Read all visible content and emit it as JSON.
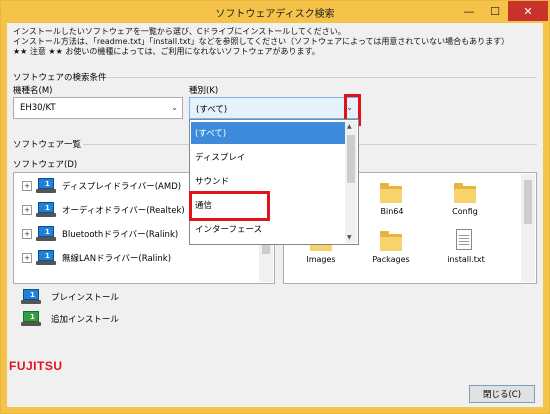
{
  "window": {
    "title": "ソフトウェアディスク検索",
    "controls": {
      "minimize": "—",
      "maximize": "☐",
      "close": "✕"
    }
  },
  "intro": {
    "line1": "インストールしたいソフトウェアを一覧から選び、Cドライブにインストールしてください。",
    "line2": "インストール方法は、「readme.txt」「install.txt」などを参照してください（ソフトウェアによっては用意されていない場合もあります）",
    "line3": "★★ 注意 ★★ お使いの機種によっては、ご利用になれないソフトウェアがあります。"
  },
  "search": {
    "group_label": "ソフトウェアの検索条件",
    "model_label": "機種名(M)",
    "model_value": "EH30/KT",
    "kind_label": "種別(K)",
    "kind_value": "(すべて)"
  },
  "kind_options": [
    "(すべて)",
    "ディスプレイ",
    "サウンド",
    "通信",
    "インターフェース"
  ],
  "list": {
    "group_label": "ソフトウェア一覧",
    "software_label": "ソフトウェア(D)",
    "items": [
      {
        "label": "ディスプレイドライバー(AMD)"
      },
      {
        "label": "オーディオドライバー(Realtek)"
      },
      {
        "label": "Bluetoothドライバー(Ralink)"
      },
      {
        "label": "無線LANドライバー(Ralink)"
      }
    ]
  },
  "files": [
    {
      "label": "Bin64",
      "type": "folder"
    },
    {
      "label": "Config",
      "type": "folder"
    },
    {
      "label": "Images",
      "type": "folder"
    },
    {
      "label": "Packages",
      "type": "folder"
    },
    {
      "label": "install.txt",
      "type": "text"
    }
  ],
  "legend": {
    "preinstall": "プレインストール",
    "addinstall": "追加インストール"
  },
  "brand": "FUJITSU",
  "close_button": "閉じる(C)",
  "icon_number": "1"
}
